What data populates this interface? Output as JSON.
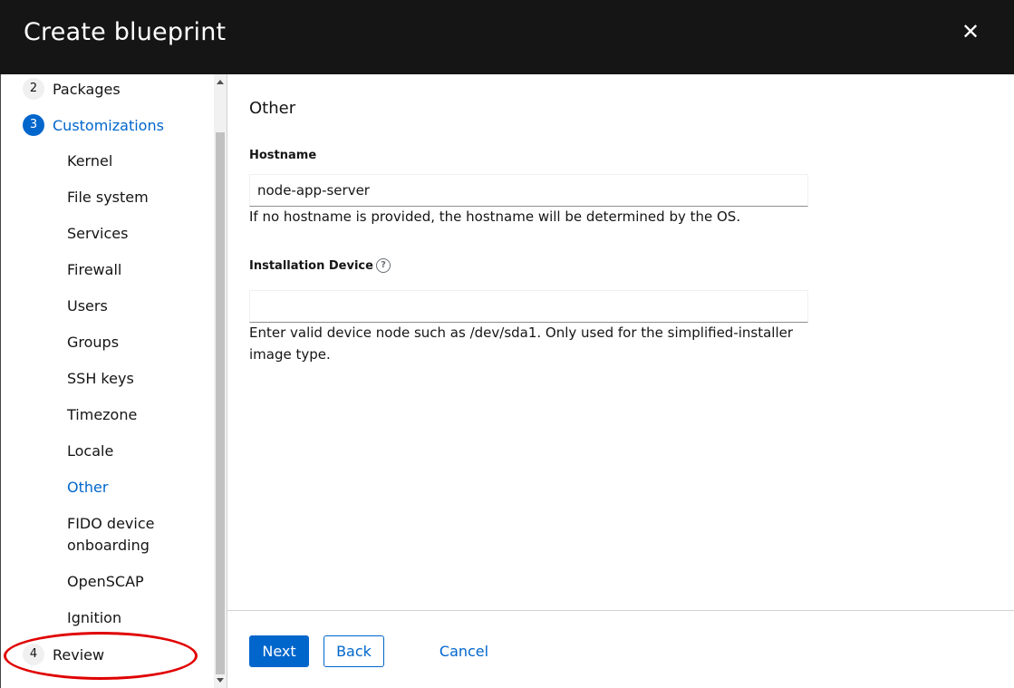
{
  "header": {
    "title": "Create blueprint",
    "close_glyph": "✕"
  },
  "nav": {
    "steps": [
      {
        "number": "2",
        "label": "Packages"
      },
      {
        "number": "3",
        "label": "Customizations"
      },
      {
        "number": "4",
        "label": "Review"
      }
    ],
    "substeps": [
      "Kernel",
      "File system",
      "Services",
      "Firewall",
      "Users",
      "Groups",
      "SSH keys",
      "Timezone",
      "Locale",
      "Other",
      "FIDO device onboarding",
      "OpenSCAP",
      "Ignition"
    ]
  },
  "main": {
    "section_title": "Other",
    "hostname": {
      "label": "Hostname",
      "value": "node-app-server",
      "helper": "If no hostname is provided, the hostname will be determined by the OS."
    },
    "installation_device": {
      "label": "Installation Device",
      "help_glyph": "?",
      "value": "",
      "helper": "Enter valid device node such as /dev/sda1. Only used for the simplified-installer image type."
    }
  },
  "footer": {
    "next_label": "Next",
    "back_label": "Back",
    "cancel_label": "Cancel"
  },
  "colors": {
    "accent": "#0066cc",
    "header_bg": "#151515",
    "highlight": "#e00000"
  }
}
